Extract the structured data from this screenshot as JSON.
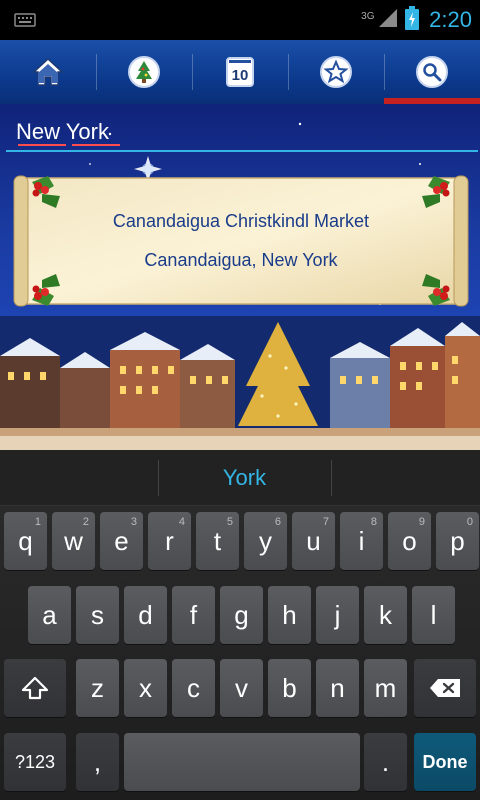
{
  "status_bar": {
    "time": "2:20",
    "network": "3G"
  },
  "toolbar": {
    "tabs": [
      {
        "name": "home",
        "icon": "home-icon"
      },
      {
        "name": "tree",
        "icon": "christmas-tree-icon"
      },
      {
        "name": "top10",
        "icon": "top10-icon",
        "label": "10"
      },
      {
        "name": "favorites",
        "icon": "star-icon"
      },
      {
        "name": "search",
        "icon": "search-icon",
        "active": true
      }
    ]
  },
  "search": {
    "value": "New York"
  },
  "result": {
    "title": "Canandaigua Christkindl Market",
    "location": "Canandaigua, New York"
  },
  "suggestion": {
    "word": "York"
  },
  "keyboard": {
    "row1": [
      {
        "k": "q",
        "h": "1"
      },
      {
        "k": "w",
        "h": "2"
      },
      {
        "k": "e",
        "h": "3"
      },
      {
        "k": "r",
        "h": "4"
      },
      {
        "k": "t",
        "h": "5"
      },
      {
        "k": "y",
        "h": "6"
      },
      {
        "k": "u",
        "h": "7"
      },
      {
        "k": "i",
        "h": "8"
      },
      {
        "k": "o",
        "h": "9"
      },
      {
        "k": "p",
        "h": "0"
      }
    ],
    "row2": [
      "a",
      "s",
      "d",
      "f",
      "g",
      "h",
      "j",
      "k",
      "l"
    ],
    "row3": [
      "z",
      "x",
      "c",
      "v",
      "b",
      "n",
      "m"
    ],
    "symbols_label": "?123",
    "comma": ",",
    "period": ".",
    "done_label": "Done"
  },
  "colors": {
    "accent": "#33b5e5",
    "active_tab": "#c62121",
    "toolbar": "#0c3a8e"
  }
}
